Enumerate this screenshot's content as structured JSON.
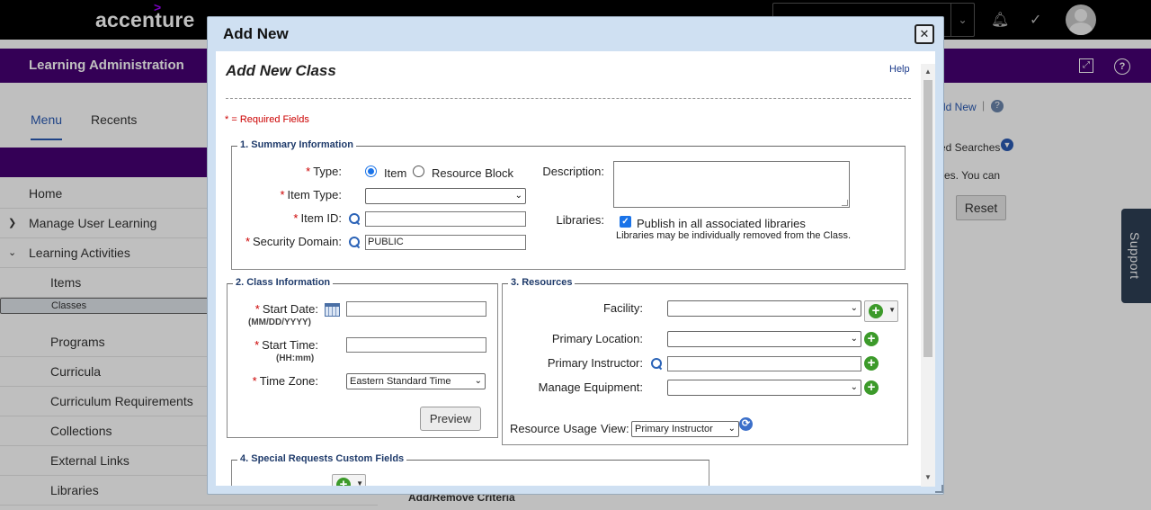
{
  "app": {
    "brand": "accenture",
    "brand_mark": ">",
    "header_title": "Learning Administration"
  },
  "sidebar": {
    "tabs": [
      {
        "label": "Menu"
      },
      {
        "label": "Recents"
      }
    ],
    "items": [
      {
        "label": "Home"
      },
      {
        "label": "Manage User Learning"
      },
      {
        "label": "Learning Activities"
      },
      {
        "label": "Items"
      },
      {
        "label": "Classes"
      },
      {
        "label": "Programs"
      },
      {
        "label": "Curricula"
      },
      {
        "label": "Curriculum Requirements"
      },
      {
        "label": "Collections"
      },
      {
        "label": "External Links"
      },
      {
        "label": "Libraries"
      }
    ]
  },
  "background": {
    "add_new_link": "dd New",
    "saved_searches": "ed Searches",
    "you_can_text": "es. You can",
    "reset_label": "Reset",
    "criteria_text": "Add/Remove Criteria",
    "support_label": "Support"
  },
  "modal": {
    "title": "Add New",
    "close_icon": "close-icon",
    "form_title": "Add New Class",
    "help_label": "Help",
    "required_note": "* = Required Fields",
    "summary": {
      "legend": "1. Summary Information",
      "type_label": "Type:",
      "type_options": [
        "Item",
        "Resource Block"
      ],
      "type_selected": "Item",
      "item_type_label": "Item Type:",
      "item_type_value": "",
      "item_id_label": "Item ID:",
      "item_id_value": "",
      "security_domain_label": "Security Domain:",
      "security_domain_value": "PUBLIC",
      "description_label": "Description:",
      "libraries_label": "Libraries:",
      "publish_label": "Publish in all associated libraries",
      "publish_checked": true,
      "libraries_note": "Libraries may be individually removed from the Class."
    },
    "class_info": {
      "legend": "2. Class Information",
      "start_date_label": "Start Date:",
      "start_date_format": "(MM/DD/YYYY)",
      "start_date_value": "",
      "start_time_label": "Start Time:",
      "start_time_format": "(HH:mm)",
      "start_time_value": "",
      "time_zone_label": "Time Zone:",
      "time_zone_value": "Eastern Standard Time",
      "preview_label": "Preview"
    },
    "resources": {
      "legend": "3. Resources",
      "facility_label": "Facility:",
      "primary_location_label": "Primary Location:",
      "primary_instructor_label": "Primary Instructor:",
      "manage_equipment_label": "Manage Equipment:",
      "resource_usage_label": "Resource Usage",
      "view_label": "View:",
      "view_value": "Primary Instructor"
    },
    "special_requests": {
      "legend": "4. Special Requests Custom Fields"
    }
  },
  "colors": {
    "brand_purple": "#460073",
    "accent_purple": "#a100ff",
    "required_red": "#cc0000",
    "add_green": "#3c9a2a",
    "modal_header": "#cfe0f2"
  }
}
